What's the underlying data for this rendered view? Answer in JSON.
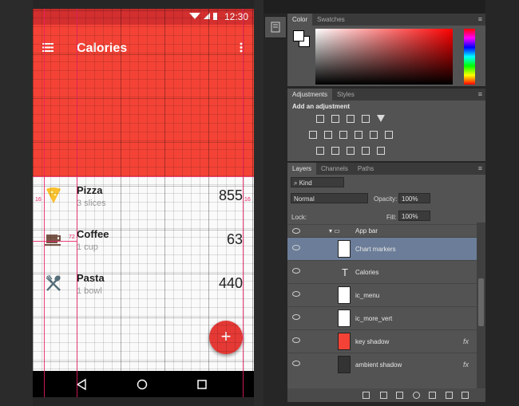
{
  "phone": {
    "status": {
      "time": "12:30"
    },
    "appbar": {
      "title": "Calories",
      "color": "#f44336"
    },
    "items": [
      {
        "name": "Pizza",
        "sub": "3 slices",
        "value": "855",
        "icon": "pizza-icon"
      },
      {
        "name": "Coffee",
        "sub": "1 cup",
        "value": "63",
        "icon": "coffee-icon"
      },
      {
        "name": "Pasta",
        "sub": "1 bowl",
        "value": "440",
        "icon": "fork-spoon-icon"
      }
    ],
    "fab_label": "+",
    "guides": {
      "left_margin": "16",
      "right_margin": "16",
      "keyline": "72"
    }
  },
  "photoshop": {
    "color_panel": {
      "tabs": [
        "Color",
        "Swatches"
      ]
    },
    "adjustments_panel": {
      "tabs": [
        "Adjustments",
        "Styles"
      ],
      "title": "Add an adjustment"
    },
    "layers_panel": {
      "tabs": [
        "Layers",
        "Channels",
        "Paths"
      ],
      "filter": "Kind",
      "blend_mode": "Normal",
      "opacity_label": "Opacity:",
      "opacity": "100%",
      "lock_label": "Lock:",
      "fill_label": "Fill:",
      "fill": "100%",
      "group_name": "App bar",
      "layers": [
        {
          "name": "Chart markers",
          "selected": true
        },
        {
          "name": "Calories",
          "type": "text"
        },
        {
          "name": "ic_menu"
        },
        {
          "name": "ic_more_vert"
        },
        {
          "name": "key shadow",
          "fx": "fx"
        },
        {
          "name": "ambient shadow",
          "fx": "fx"
        }
      ]
    }
  }
}
